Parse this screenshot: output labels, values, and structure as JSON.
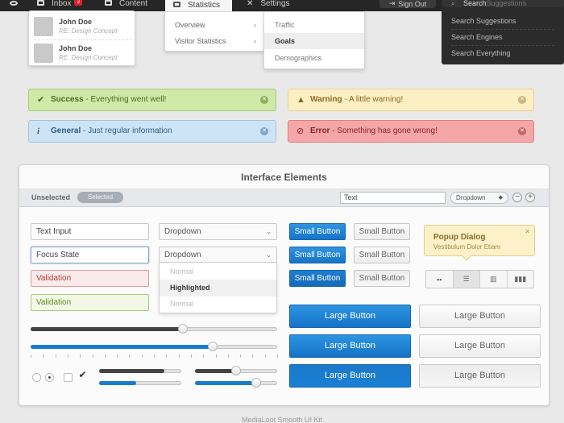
{
  "nav": {
    "inbox": "Inbox",
    "inbox_badge": "2",
    "content": "Content",
    "statistics": "Statistics",
    "settings": "Settings",
    "signout": "Sign Out",
    "search_typed": "Search",
    "search_placeholder": "Suggestions"
  },
  "messages": [
    {
      "name": "John Doe",
      "subject": "RE: Design Concept"
    },
    {
      "name": "John Doe",
      "subject": "RE: Design Concept"
    }
  ],
  "stats_menu": [
    "Overview",
    "Visitor Statistics"
  ],
  "stats_submenu": [
    "Traffic",
    "Goals",
    "Demographics"
  ],
  "search_menu": [
    "Search Suggestions",
    "Search Engines",
    "Search Everything"
  ],
  "alerts": {
    "success": {
      "title": "Success",
      "text": " - Everything went well!"
    },
    "warning": {
      "title": "Warning",
      "text": " - A little warning!"
    },
    "general": {
      "title": "General",
      "text": " - Just regular information"
    },
    "error": {
      "title": "Error",
      "text": " - Something has gone wrong!"
    }
  },
  "card": {
    "title": "Interface Elements",
    "seg_unselected": "Unselected",
    "seg_selected": "Selected",
    "toolbar_text": "Text",
    "toolbar_dropdown": "Dropdown",
    "minus": "−",
    "plus": "+"
  },
  "inputs": {
    "text": "Text Input",
    "focus": "Focus State",
    "validation_error": "Validation",
    "validation_ok": "Validation"
  },
  "dropdowns": {
    "closed": "Dropdown",
    "open": "Dropdown",
    "options": [
      "Normal",
      "Highlighted",
      "Normal"
    ]
  },
  "buttons": {
    "small": "Small Button",
    "large": "Large Button"
  },
  "popup": {
    "title": "Popup Dialog",
    "subtitle": "Vestibulum Dolor Etiam"
  },
  "sliders": {
    "dark_slider": 0.62,
    "blue_slider": 0.74,
    "mini_dark_1": 0.8,
    "mini_blue_1": 0.45,
    "mini_dark_2": 0.5,
    "mini_blue_2": 0.75
  },
  "footer": "MediaLoot Smooth UI Kit",
  "colors": {
    "accent_blue": "#1a7ccd",
    "success": "#cfe9a8",
    "warning": "#fcefc3",
    "info": "#cde4f6",
    "error": "#f5a7a7"
  }
}
